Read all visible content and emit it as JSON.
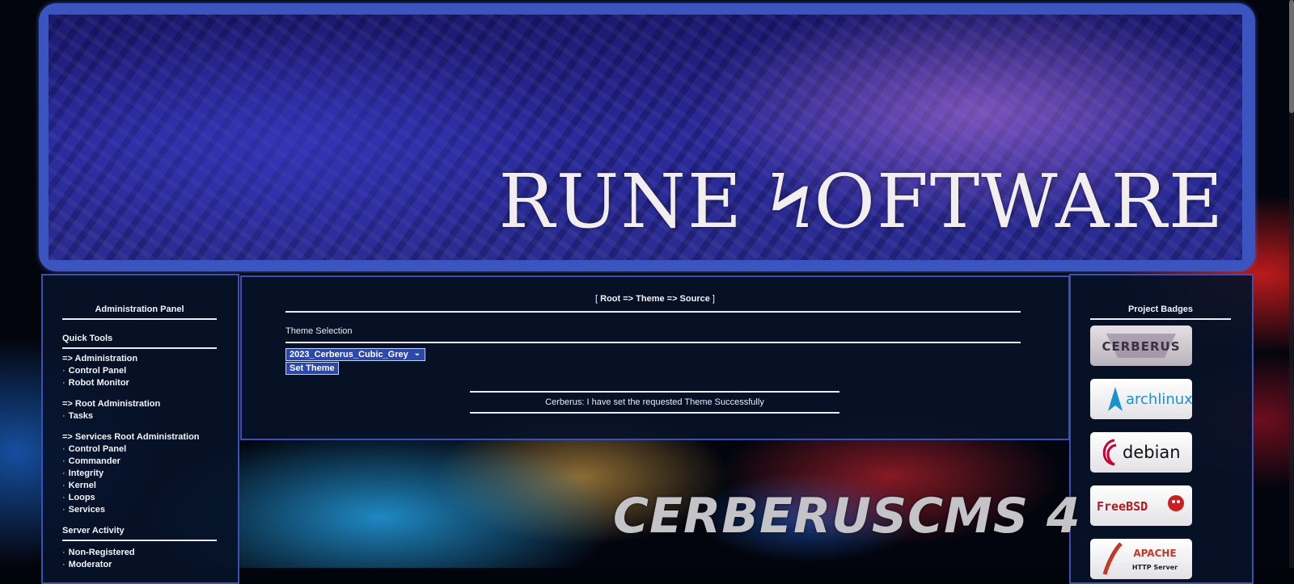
{
  "header": {
    "logo_text": "RUNE ϞOFTWARE"
  },
  "left_panel": {
    "title": "Administration Panel",
    "quick_tools": {
      "heading": "Quick Tools",
      "groups": [
        {
          "label": "=> Administration",
          "items": [
            "Control Panel",
            "Robot Monitor"
          ]
        },
        {
          "label": "=> Root Administration",
          "items": [
            "Tasks"
          ]
        },
        {
          "label": "=> Services Root Administration",
          "items": [
            "Control Panel",
            "Commander",
            "Integrity",
            "Kernel",
            "Loops",
            "Services"
          ]
        }
      ]
    },
    "server_activity": {
      "heading": "Server Activity",
      "items": [
        "Non-Registered",
        "Moderator"
      ]
    },
    "bullet": "·"
  },
  "center_panel": {
    "breadcrumb": {
      "open": "[ ",
      "path": "Root => Theme => Source",
      "close": " ]"
    },
    "theme_label": "Theme Selection",
    "theme_select_value": "2023_Cerberus_Cubic_Grey",
    "set_button": "Set Theme",
    "status_message": "Cerberus: I have set the requested Theme Successfully"
  },
  "right_panel": {
    "title": "Project Badges",
    "badges": [
      "CERBERUS",
      "archlinux",
      "debian",
      "FreeBSD",
      "APACHE",
      "HTTP Server"
    ]
  },
  "footer_art": {
    "title": "CERBERUSCMS 4"
  },
  "colors": {
    "frame": "#3c54c0",
    "panel_bg": "#06122a",
    "button_bg": "#2c48a8"
  }
}
